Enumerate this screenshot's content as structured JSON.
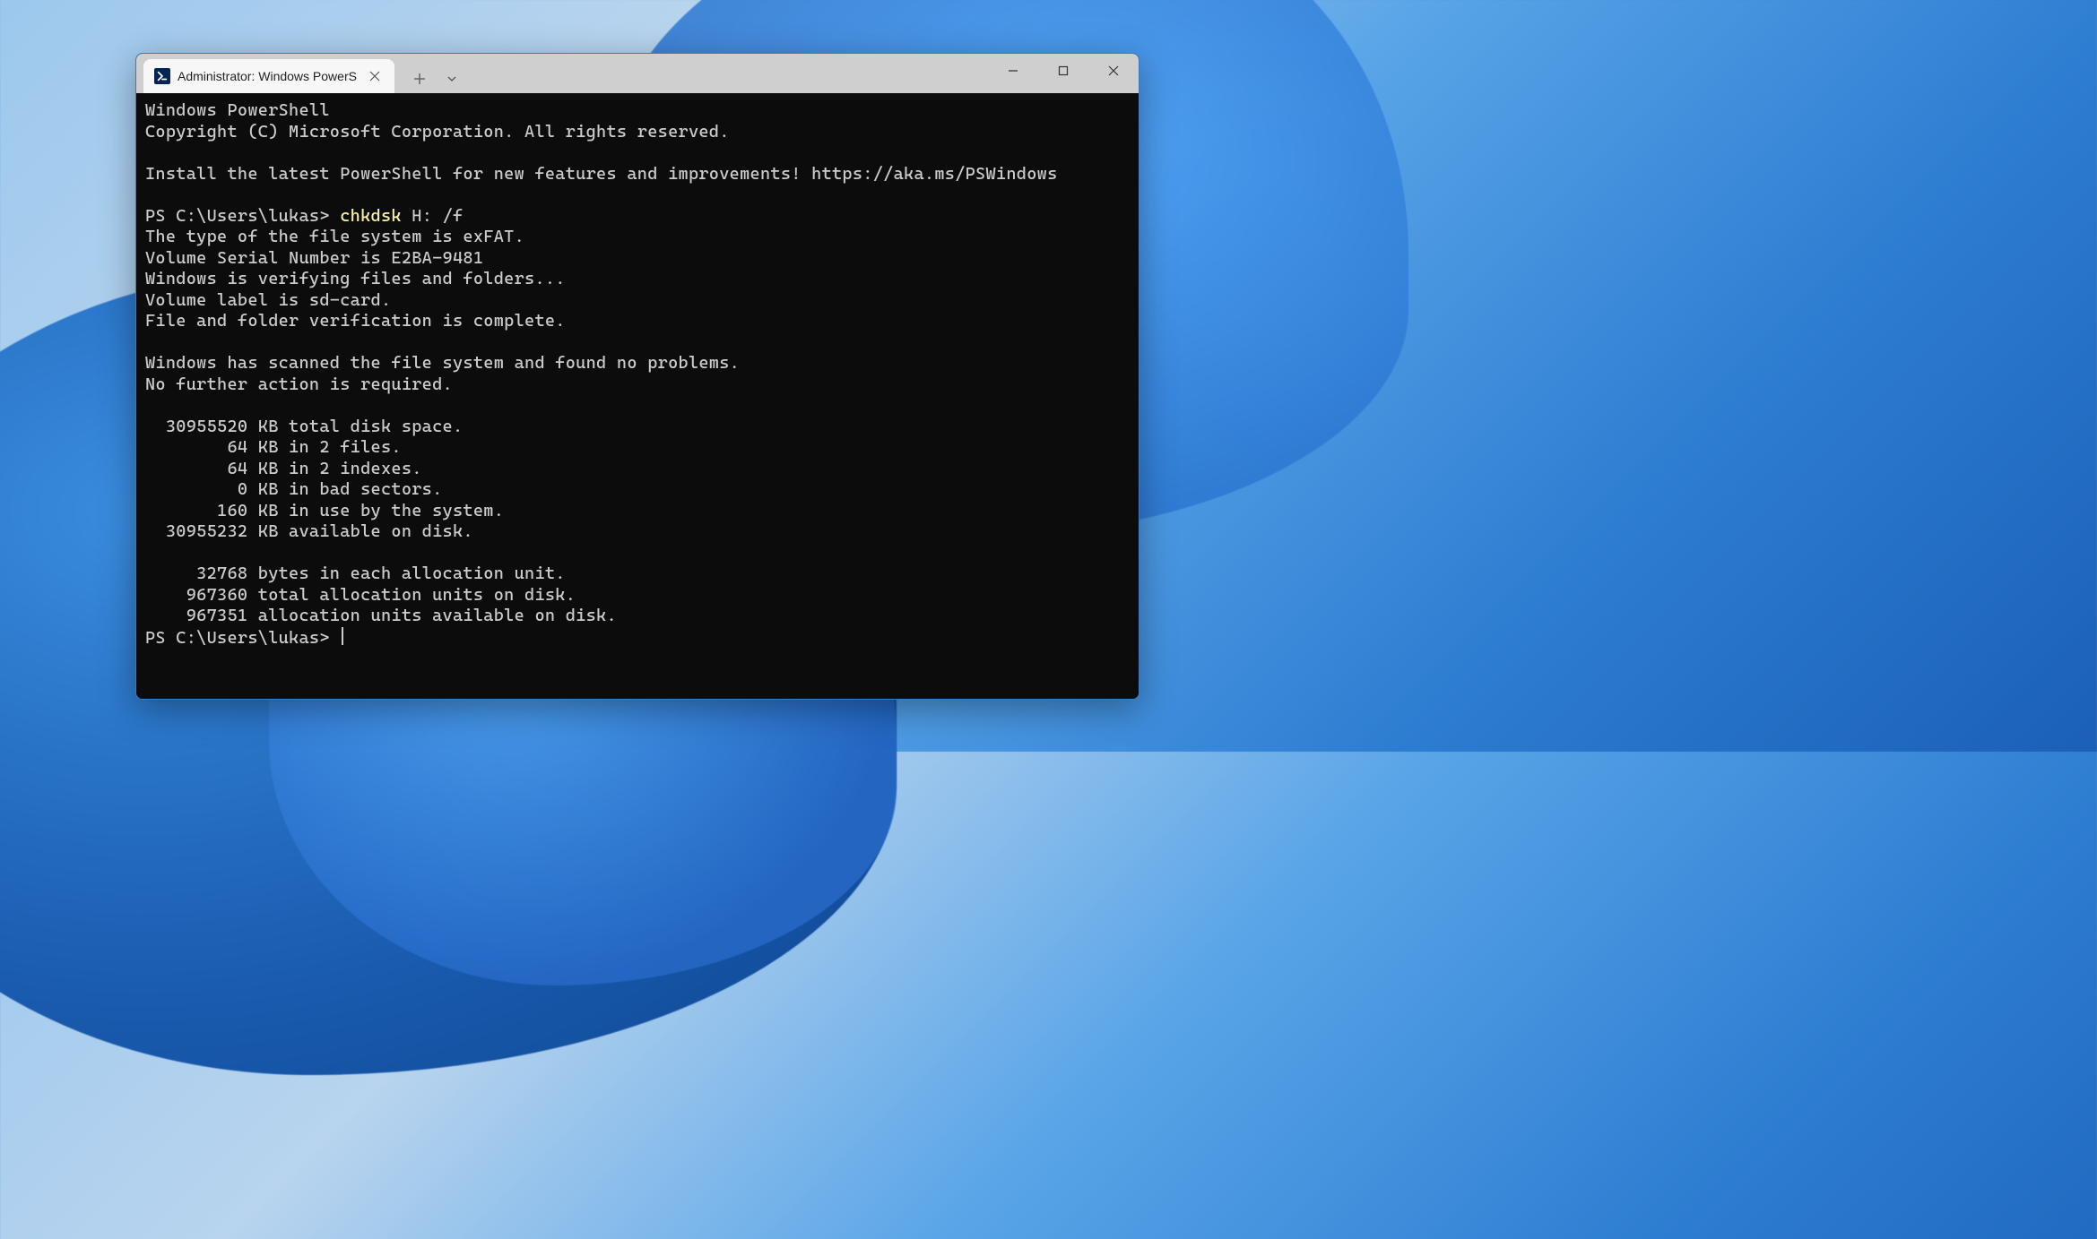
{
  "tab": {
    "title": "Administrator: Windows PowerS"
  },
  "terminal": {
    "banner1": "Windows PowerShell",
    "banner2": "Copyright (C) Microsoft Corporation. All rights reserved.",
    "install": "Install the latest PowerShell for new features and improvements! https://aka.ms/PSWindows",
    "prompt1_prefix": "PS C:\\Users\\lukas> ",
    "cmd": "chkdsk",
    "cmd_args": " H: /f",
    "out1": "The type of the file system is exFAT.",
    "out2": "Volume Serial Number is E2BA-9481",
    "out3": "Windows is verifying files and folders...",
    "out4": "Volume label is sd-card.",
    "out5": "File and folder verification is complete.",
    "out6": "Windows has scanned the file system and found no problems.",
    "out7": "No further action is required.",
    "stat1": "  30955520 KB total disk space.",
    "stat2": "        64 KB in 2 files.",
    "stat3": "        64 KB in 2 indexes.",
    "stat4": "         0 KB in bad sectors.",
    "stat5": "       160 KB in use by the system.",
    "stat6": "  30955232 KB available on disk.",
    "stat7": "     32768 bytes in each allocation unit.",
    "stat8": "    967360 total allocation units on disk.",
    "stat9": "    967351 allocation units available on disk.",
    "prompt2": "PS C:\\Users\\lukas> "
  }
}
